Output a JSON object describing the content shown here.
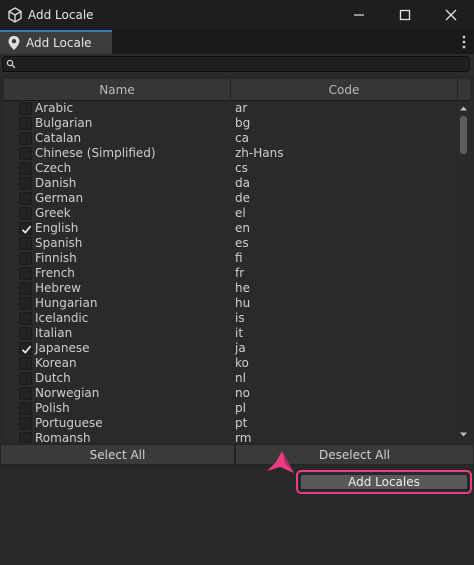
{
  "window": {
    "title": "Add Locale",
    "tab_label": "Add Locale",
    "app_icon": "unity-icon",
    "controls": [
      "minimize-icon",
      "maximize-icon",
      "close-icon"
    ]
  },
  "search": {
    "placeholder": ""
  },
  "table": {
    "columns": [
      "Name",
      "Code"
    ],
    "rows": [
      {
        "name": "Arabic",
        "code": "ar",
        "checked": false
      },
      {
        "name": "Bulgarian",
        "code": "bg",
        "checked": false
      },
      {
        "name": "Catalan",
        "code": "ca",
        "checked": false
      },
      {
        "name": "Chinese (Simplified)",
        "code": "zh-Hans",
        "checked": false
      },
      {
        "name": "Czech",
        "code": "cs",
        "checked": false
      },
      {
        "name": "Danish",
        "code": "da",
        "checked": false
      },
      {
        "name": "German",
        "code": "de",
        "checked": false
      },
      {
        "name": "Greek",
        "code": "el",
        "checked": false
      },
      {
        "name": "English",
        "code": "en",
        "checked": true
      },
      {
        "name": "Spanish",
        "code": "es",
        "checked": false
      },
      {
        "name": "Finnish",
        "code": "fi",
        "checked": false
      },
      {
        "name": "French",
        "code": "fr",
        "checked": false
      },
      {
        "name": "Hebrew",
        "code": "he",
        "checked": false
      },
      {
        "name": "Hungarian",
        "code": "hu",
        "checked": false
      },
      {
        "name": "Icelandic",
        "code": "is",
        "checked": false
      },
      {
        "name": "Italian",
        "code": "it",
        "checked": false
      },
      {
        "name": "Japanese",
        "code": "ja",
        "checked": true
      },
      {
        "name": "Korean",
        "code": "ko",
        "checked": false
      },
      {
        "name": "Dutch",
        "code": "nl",
        "checked": false
      },
      {
        "name": "Norwegian",
        "code": "no",
        "checked": false
      },
      {
        "name": "Polish",
        "code": "pl",
        "checked": false
      },
      {
        "name": "Portuguese",
        "code": "pt",
        "checked": false
      },
      {
        "name": "Romansh",
        "code": "rm",
        "checked": false
      }
    ]
  },
  "buttons": {
    "select_all": "Select All",
    "deselect_all": "Deselect All",
    "add_locales": "Add Locales"
  },
  "colors": {
    "accent_tab": "#3a79bb",
    "highlight": "#e83f82"
  }
}
